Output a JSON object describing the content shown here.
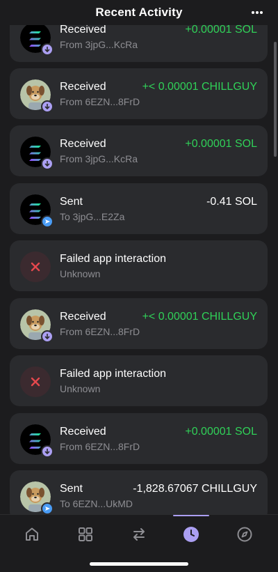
{
  "header": {
    "title": "Recent Activity",
    "more_icon": "more-dots-icon"
  },
  "transactions": [
    {
      "title": "Received",
      "subtitle": "From 3jpG...KcRa",
      "amount": "+0.00001 SOL",
      "type": "received",
      "token": "SOL"
    },
    {
      "title": "Received",
      "subtitle": "From 6EZN...8FrD",
      "amount": "+< 0.00001 CHILLGUY",
      "type": "received",
      "token": "CHILLGUY"
    },
    {
      "title": "Received",
      "subtitle": "From 3jpG...KcRa",
      "amount": "+0.00001 SOL",
      "type": "received",
      "token": "SOL"
    },
    {
      "title": "Sent",
      "subtitle": "To 3jpG...E2Za",
      "amount": "-0.41 SOL",
      "type": "sent",
      "token": "SOL"
    },
    {
      "title": "Failed app interaction",
      "subtitle": "Unknown",
      "amount": "",
      "type": "failed",
      "token": ""
    },
    {
      "title": "Received",
      "subtitle": "From 6EZN...8FrD",
      "amount": "+< 0.00001 CHILLGUY",
      "type": "received",
      "token": "CHILLGUY"
    },
    {
      "title": "Failed app interaction",
      "subtitle": "Unknown",
      "amount": "",
      "type": "failed",
      "token": ""
    },
    {
      "title": "Received",
      "subtitle": "From 6EZN...8FrD",
      "amount": "+0.00001 SOL",
      "type": "received",
      "token": "SOL"
    },
    {
      "title": "Sent",
      "subtitle": "To 6EZN...UkMD",
      "amount": "-1,828.67067 CHILLGUY",
      "type": "sent",
      "token": "CHILLGUY"
    }
  ],
  "tabs": [
    {
      "name": "home",
      "icon": "home-icon"
    },
    {
      "name": "collectibles",
      "icon": "grid-icon"
    },
    {
      "name": "swap",
      "icon": "swap-icon"
    },
    {
      "name": "activity",
      "icon": "clock-icon",
      "active": true
    },
    {
      "name": "explore",
      "icon": "compass-icon"
    }
  ],
  "colors": {
    "positive": "#30d158",
    "accent": "#ab9ff2",
    "sent_badge": "#4a9cf5",
    "fail": "#e5484d"
  }
}
